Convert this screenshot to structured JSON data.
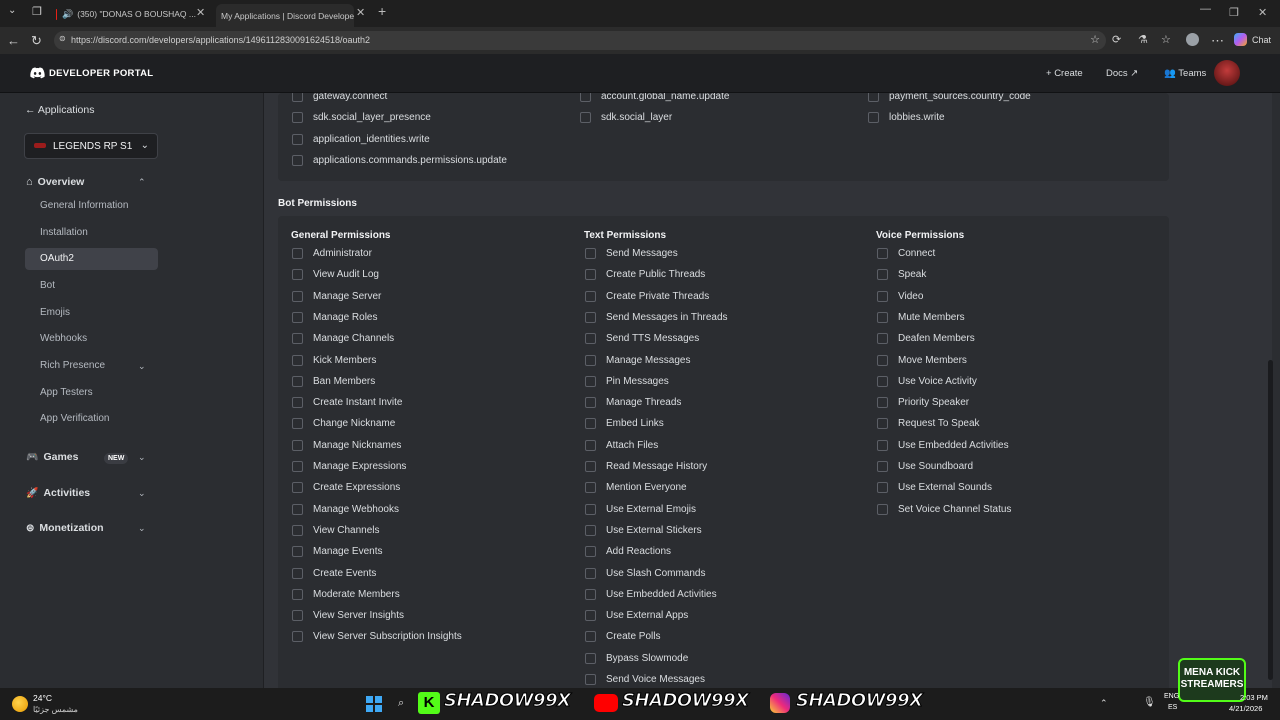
{
  "browser": {
    "tabs": [
      {
        "title": "(350) \"DONAS O BOUSHAQ ..."
      },
      {
        "title": "My Applications | Discord Developer"
      }
    ],
    "url": "https://discord.com/developers/applications/1496112830091624518/oauth2",
    "chat_label": "Chat"
  },
  "header": {
    "brand": "DEVELOPER PORTAL",
    "create": "Create",
    "docs": "Docs",
    "teams": "Teams"
  },
  "sidebar": {
    "back": "Applications",
    "app_name": "LEGENDS RP S1",
    "overview": "Overview",
    "items": [
      "General Information",
      "Installation",
      "OAuth2",
      "Bot",
      "Emojis",
      "Webhooks",
      "Rich Presence",
      "App Testers",
      "App Verification"
    ],
    "games": "Games",
    "games_badge": "NEW",
    "activities": "Activities",
    "monetization": "Monetization"
  },
  "scopes": {
    "col1": [
      "gateway.connect",
      "sdk.social_layer_presence",
      "application_identities.write",
      "applications.commands.permissions.update"
    ],
    "col2": [
      "account.global_name.update",
      "sdk.social_layer"
    ],
    "col3": [
      "payment_sources.country_code",
      "lobbies.write"
    ]
  },
  "bot_permissions": {
    "title": "Bot Permissions",
    "general": {
      "heading": "General Permissions",
      "items": [
        "Administrator",
        "View Audit Log",
        "Manage Server",
        "Manage Roles",
        "Manage Channels",
        "Kick Members",
        "Ban Members",
        "Create Instant Invite",
        "Change Nickname",
        "Manage Nicknames",
        "Manage Expressions",
        "Create Expressions",
        "Manage Webhooks",
        "View Channels",
        "Manage Events",
        "Create Events",
        "Moderate Members",
        "View Server Insights",
        "View Server Subscription Insights"
      ]
    },
    "text": {
      "heading": "Text Permissions",
      "items": [
        "Send Messages",
        "Create Public Threads",
        "Create Private Threads",
        "Send Messages in Threads",
        "Send TTS Messages",
        "Manage Messages",
        "Pin Messages",
        "Manage Threads",
        "Embed Links",
        "Attach Files",
        "Read Message History",
        "Mention Everyone",
        "Use External Emojis",
        "Use External Stickers",
        "Add Reactions",
        "Use Slash Commands",
        "Use Embedded Activities",
        "Use External Apps",
        "Create Polls",
        "Bypass Slowmode",
        "Send Voice Messages"
      ]
    },
    "voice": {
      "heading": "Voice Permissions",
      "items": [
        "Connect",
        "Speak",
        "Video",
        "Mute Members",
        "Deafen Members",
        "Move Members",
        "Use Voice Activity",
        "Priority Speaker",
        "Request To Speak",
        "Use Embedded Activities",
        "Use Soundboard",
        "Use External Sounds",
        "Set Voice Channel Status"
      ]
    }
  },
  "taskbar": {
    "weather_temp": "24°C",
    "weather_desc": "مشمس جزئيًا",
    "overlay": "SHADOW99X",
    "badge_line1": "MENA KICK",
    "badge_line2": "STREAMERS",
    "lang1": "ENG",
    "lang2": "ES",
    "time": "2:03 PM",
    "date": "4/21/2026"
  }
}
